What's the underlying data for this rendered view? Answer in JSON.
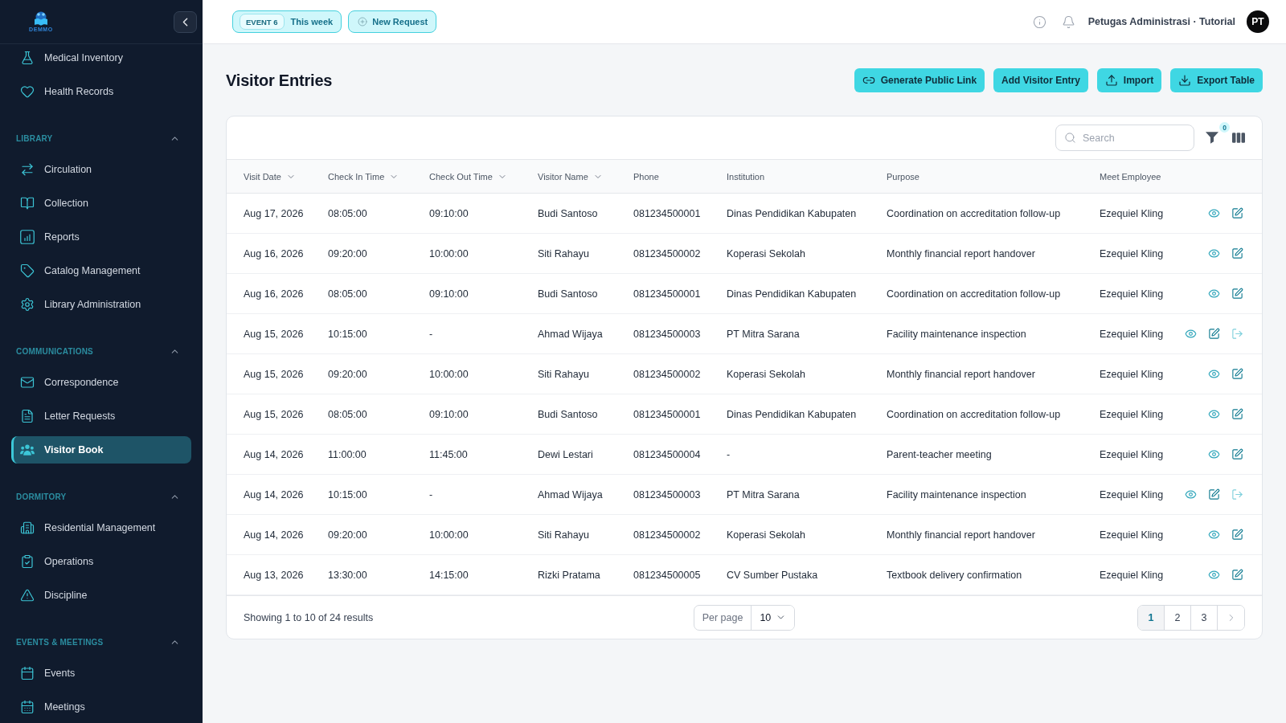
{
  "sidebar": {
    "logo_text": "DEMMO",
    "sections": [
      {
        "items": [
          {
            "label": "Medical Inventory",
            "selected": false
          },
          {
            "label": "Health Records",
            "selected": false
          }
        ]
      },
      {
        "title": "LIBRARY",
        "expanded": true,
        "items": [
          {
            "label": "Circulation",
            "selected": false
          },
          {
            "label": "Collection",
            "selected": false
          },
          {
            "label": "Reports",
            "selected": false
          },
          {
            "label": "Catalog Management",
            "selected": false
          },
          {
            "label": "Library Administration",
            "selected": false
          }
        ]
      },
      {
        "title": "COMMUNICATIONS",
        "expanded": true,
        "items": [
          {
            "label": "Correspondence",
            "selected": false
          },
          {
            "label": "Letter Requests",
            "selected": false
          },
          {
            "label": "Visitor Book",
            "selected": true
          }
        ]
      },
      {
        "title": "DORMITORY",
        "expanded": true,
        "items": [
          {
            "label": "Residential Management",
            "selected": false
          },
          {
            "label": "Operations",
            "selected": false
          },
          {
            "label": "Discipline",
            "selected": false
          }
        ]
      },
      {
        "title": "EVENTS & MEETINGS",
        "expanded": true,
        "items": [
          {
            "label": "Events",
            "selected": false
          },
          {
            "label": "Meetings",
            "selected": false
          }
        ]
      }
    ]
  },
  "topbar": {
    "event_chip": {
      "badge": "EVENT 6",
      "label": "This week"
    },
    "new_request": "New Request",
    "user": "Petugas Administrasi · Tutorial",
    "avatar": "PT"
  },
  "page": {
    "title": "Visitor Entries",
    "actions": [
      {
        "label": "Generate Public Link",
        "kind": "link"
      },
      {
        "label": "Add Visitor Entry",
        "kind": "plain"
      },
      {
        "label": "Import",
        "kind": "upload"
      },
      {
        "label": "Export Table",
        "kind": "download"
      }
    ]
  },
  "table": {
    "search": {
      "placeholder": "Search"
    },
    "filter_count": "0",
    "columns": [
      {
        "label": "Visit Date",
        "sortable": true
      },
      {
        "label": "Check In Time",
        "sortable": true
      },
      {
        "label": "Check Out Time",
        "sortable": true
      },
      {
        "label": "Visitor Name",
        "sortable": true
      },
      {
        "label": "Phone",
        "sortable": false
      },
      {
        "label": "Institution",
        "sortable": false
      },
      {
        "label": "Purpose",
        "sortable": false
      },
      {
        "label": "Meet Employee",
        "sortable": false
      }
    ],
    "rows": [
      {
        "cells": [
          "Aug 17, 2026",
          "08:05:00",
          "09:10:00",
          "Budi Santoso",
          "081234500001",
          "Dinas Pendidikan Kabupaten",
          "Coordination on accreditation follow-up",
          "Ezequiel Kling"
        ],
        "actions": [
          {
            "kind": "view"
          },
          {
            "kind": "edit"
          }
        ]
      },
      {
        "cells": [
          "Aug 16, 2026",
          "09:20:00",
          "10:00:00",
          "Siti Rahayu",
          "081234500002",
          "Koperasi Sekolah",
          "Monthly financial report handover",
          "Ezequiel Kling"
        ],
        "actions": [
          {
            "kind": "view"
          },
          {
            "kind": "edit"
          }
        ]
      },
      {
        "cells": [
          "Aug 16, 2026",
          "08:05:00",
          "09:10:00",
          "Budi Santoso",
          "081234500001",
          "Dinas Pendidikan Kabupaten",
          "Coordination on accreditation follow-up",
          "Ezequiel Kling"
        ],
        "actions": [
          {
            "kind": "view"
          },
          {
            "kind": "edit"
          }
        ]
      },
      {
        "cells": [
          "Aug 15, 2026",
          "10:15:00",
          "-",
          "Ahmad Wijaya",
          "081234500003",
          "PT Mitra Sarana",
          "Facility maintenance inspection",
          "Ezequiel Kling"
        ],
        "actions": [
          {
            "kind": "view"
          },
          {
            "kind": "edit"
          },
          {
            "kind": "check_out"
          }
        ]
      },
      {
        "cells": [
          "Aug 15, 2026",
          "09:20:00",
          "10:00:00",
          "Siti Rahayu",
          "081234500002",
          "Koperasi Sekolah",
          "Monthly financial report handover",
          "Ezequiel Kling"
        ],
        "actions": [
          {
            "kind": "view"
          },
          {
            "kind": "edit"
          }
        ]
      },
      {
        "cells": [
          "Aug 15, 2026",
          "08:05:00",
          "09:10:00",
          "Budi Santoso",
          "081234500001",
          "Dinas Pendidikan Kabupaten",
          "Coordination on accreditation follow-up",
          "Ezequiel Kling"
        ],
        "actions": [
          {
            "kind": "view"
          },
          {
            "kind": "edit"
          }
        ]
      },
      {
        "cells": [
          "Aug 14, 2026",
          "11:00:00",
          "11:45:00",
          "Dewi Lestari",
          "081234500004",
          "-",
          "Parent-teacher meeting",
          "Ezequiel Kling"
        ],
        "actions": [
          {
            "kind": "view"
          },
          {
            "kind": "edit"
          }
        ]
      },
      {
        "cells": [
          "Aug 14, 2026",
          "10:15:00",
          "-",
          "Ahmad Wijaya",
          "081234500003",
          "PT Mitra Sarana",
          "Facility maintenance inspection",
          "Ezequiel Kling"
        ],
        "actions": [
          {
            "kind": "view"
          },
          {
            "kind": "edit"
          },
          {
            "kind": "check_out"
          }
        ]
      },
      {
        "cells": [
          "Aug 14, 2026",
          "09:20:00",
          "10:00:00",
          "Siti Rahayu",
          "081234500002",
          "Koperasi Sekolah",
          "Monthly financial report handover",
          "Ezequiel Kling"
        ],
        "actions": [
          {
            "kind": "view"
          },
          {
            "kind": "edit"
          }
        ]
      },
      {
        "cells": [
          "Aug 13, 2026",
          "13:30:00",
          "14:15:00",
          "Rizki Pratama",
          "081234500005",
          "CV Sumber Pustaka",
          "Textbook delivery confirmation",
          "Ezequiel Kling"
        ],
        "actions": [
          {
            "kind": "view"
          },
          {
            "kind": "edit"
          }
        ]
      }
    ]
  },
  "footer": {
    "summary": "Showing 1 to 10 of 24 results",
    "per_page": {
      "label": "Per page",
      "value": "10"
    },
    "pages": [
      {
        "label": "1",
        "selected": true
      },
      {
        "label": "2",
        "selected": false
      },
      {
        "label": "3",
        "selected": false
      }
    ]
  }
}
